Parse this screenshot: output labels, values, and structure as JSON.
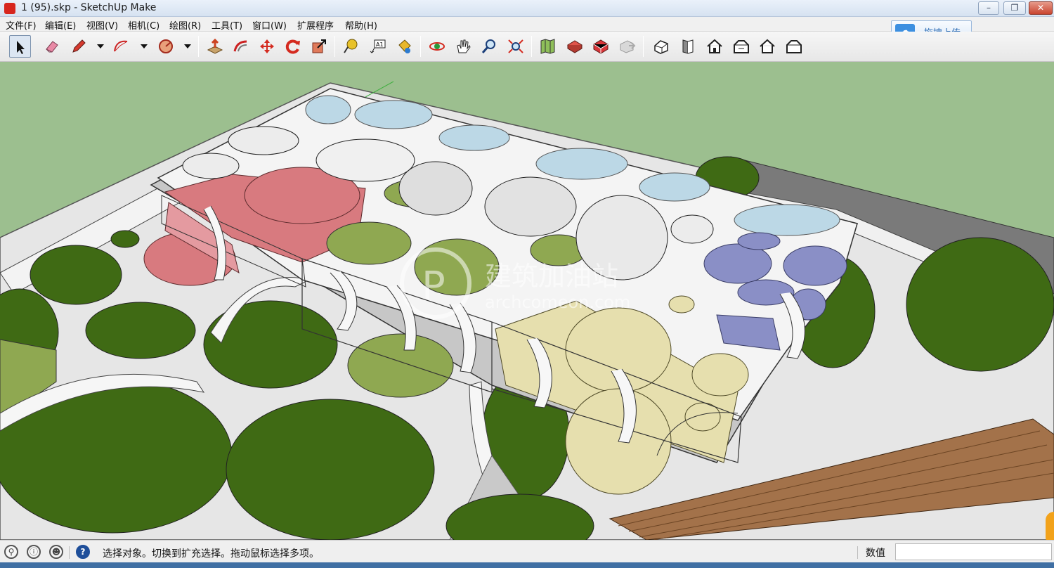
{
  "window": {
    "title": "1 (95).skp - SketchUp Make",
    "minimize_glyph": "–",
    "maximize_glyph": "❐",
    "close_glyph": "✕"
  },
  "menu": [
    "文件(F)",
    "编辑(E)",
    "视图(V)",
    "相机(C)",
    "绘图(R)",
    "工具(T)",
    "窗口(W)",
    "扩展程序",
    "帮助(H)"
  ],
  "upload": {
    "label": "拖拽上传",
    "icon": "cloud-upload-icon"
  },
  "toolbar": {
    "tools": [
      {
        "name": "select-tool",
        "icon": "cursor-arrow-icon"
      },
      {
        "name": "eraser-tool",
        "icon": "eraser-icon"
      },
      {
        "name": "line-tool",
        "icon": "pencil-icon"
      },
      {
        "name": "arc-tool",
        "icon": "arc-icon"
      },
      {
        "name": "shape-tool",
        "icon": "polygon-icon"
      },
      {
        "name": "push-pull-tool",
        "icon": "push-pull-icon"
      },
      {
        "name": "offset-tool",
        "icon": "offset-icon"
      },
      {
        "name": "move-tool",
        "icon": "move-arrows-icon"
      },
      {
        "name": "rotate-tool",
        "icon": "rotate-icon"
      },
      {
        "name": "scale-tool",
        "icon": "scale-icon"
      },
      {
        "name": "tape-measure-tool",
        "icon": "tape-measure-icon"
      },
      {
        "name": "text-tool",
        "icon": "text-label-icon"
      },
      {
        "name": "paint-bucket-tool",
        "icon": "paint-bucket-icon"
      },
      {
        "name": "orbit-tool",
        "icon": "orbit-icon"
      },
      {
        "name": "pan-tool",
        "icon": "hand-icon"
      },
      {
        "name": "zoom-tool",
        "icon": "magnifier-icon"
      },
      {
        "name": "zoom-extents-tool",
        "icon": "zoom-extents-icon"
      },
      {
        "name": "add-location-tool",
        "icon": "map-icon"
      },
      {
        "name": "photo-textures-tool",
        "icon": "photo-textures-icon"
      },
      {
        "name": "3d-warehouse-tool",
        "icon": "warehouse-icon"
      },
      {
        "name": "share-model-tool",
        "icon": "share-model-icon"
      },
      {
        "name": "iso-view-button",
        "icon": "iso-house-icon"
      },
      {
        "name": "top-view-button",
        "icon": "top-view-icon"
      },
      {
        "name": "front-view-button",
        "icon": "front-house-icon"
      },
      {
        "name": "right-view-button",
        "icon": "right-house-icon"
      },
      {
        "name": "back-view-button",
        "icon": "back-house-icon"
      },
      {
        "name": "left-view-button",
        "icon": "left-house-icon"
      }
    ]
  },
  "viewport": {
    "watermark_title": "建筑加油站",
    "watermark_url": "archcomeon.com",
    "colors": {
      "sky_ground": "#9cbf8f",
      "plaza": "#e6e6e6",
      "lawn": "#3f6a14",
      "pale_lawn": "#8fa851",
      "roof_white": "#f4f4f4",
      "pink": "#d87a7f",
      "lavender": "#8a8fc6",
      "cream": "#e6dfae",
      "glass": "#bcd8e6",
      "deck": "#a3724a",
      "road": "#7a7a7a"
    }
  },
  "status": {
    "message": "选择对象。切换到扩充选择。拖动鼠标选择多项。",
    "measure_label": "数值",
    "measure_value": "",
    "icons": [
      "geo-location-icon",
      "credits-icon",
      "user-icon",
      "help-icon"
    ]
  }
}
